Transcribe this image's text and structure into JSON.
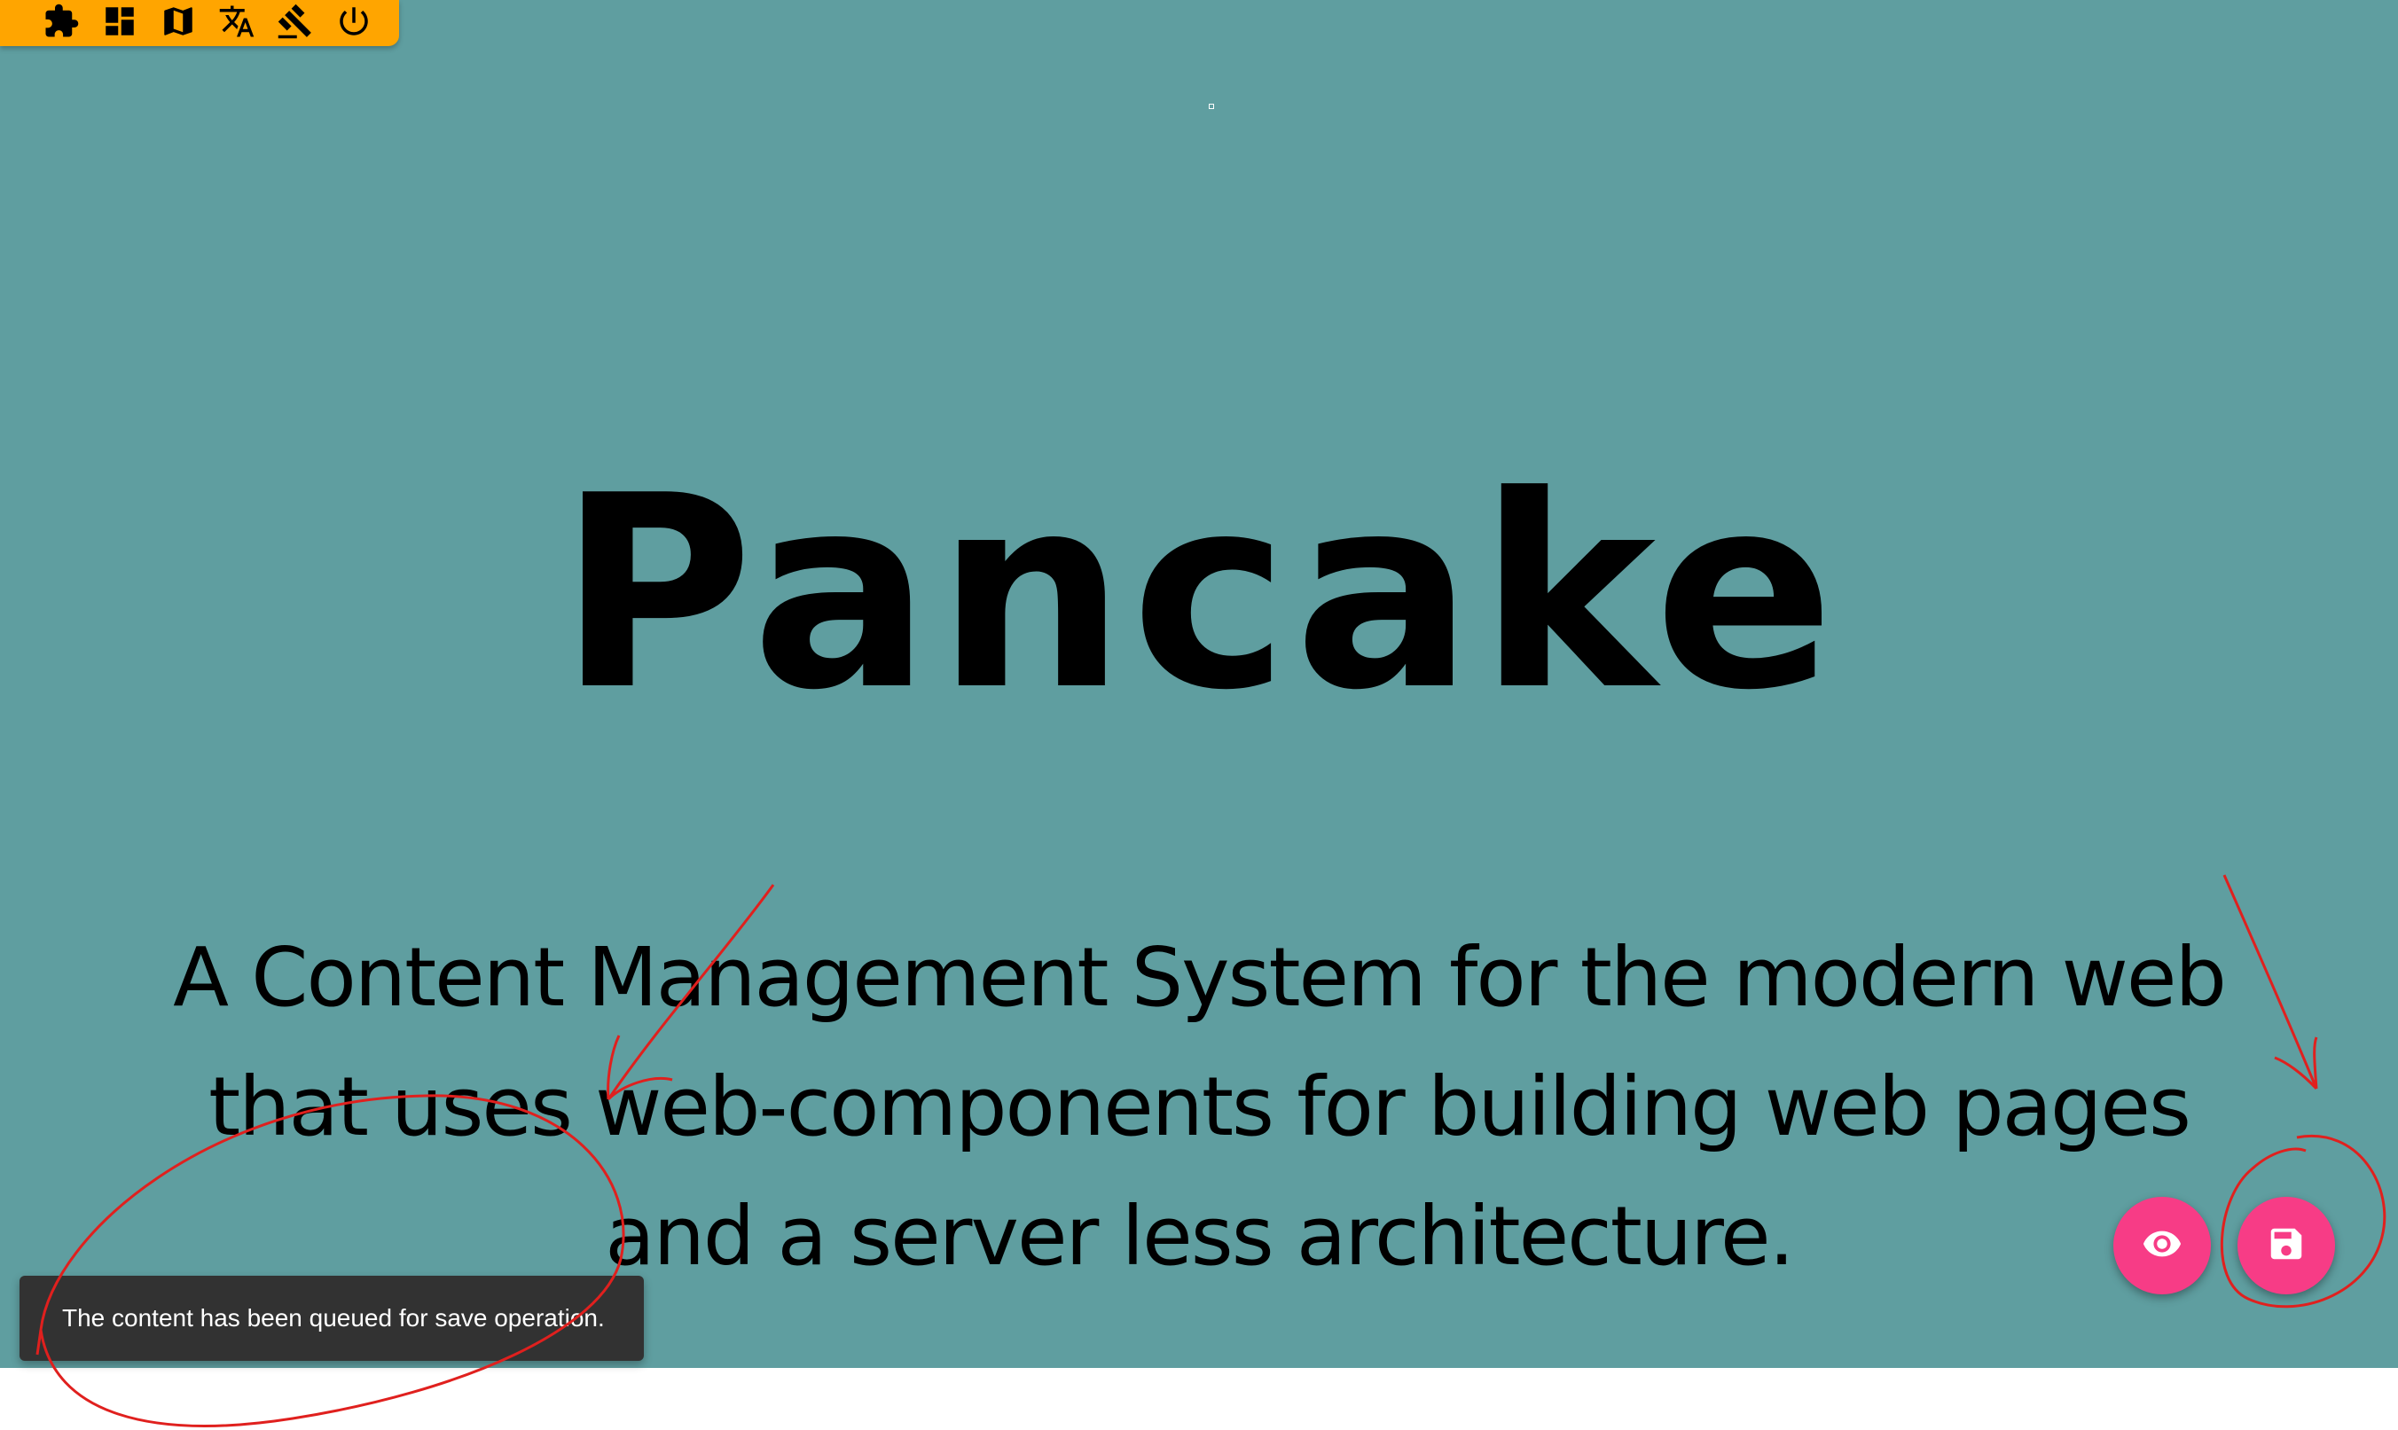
{
  "colors": {
    "page_background": "#5f9ea0",
    "toolbar_background": "#ffa500",
    "fab_background": "#f73c86",
    "snackbar_background": "#323232",
    "snackbar_text": "#ffffff",
    "annotation_stroke": "#e0201e"
  },
  "toolbar": {
    "items": [
      {
        "icon": "puzzle-icon"
      },
      {
        "icon": "dashboard-icon"
      },
      {
        "icon": "map-icon"
      },
      {
        "icon": "translate-icon"
      },
      {
        "icon": "gavel-icon"
      },
      {
        "icon": "power-icon"
      }
    ]
  },
  "hero": {
    "title": "Pancake",
    "subtitle": "A Content Management System for the modern web that uses web-components for building web pages and a server less architecture."
  },
  "fabs": {
    "preview_icon": "eye-icon",
    "save_icon": "save-icon"
  },
  "snackbar": {
    "message": "The content has been queued for save operation."
  }
}
